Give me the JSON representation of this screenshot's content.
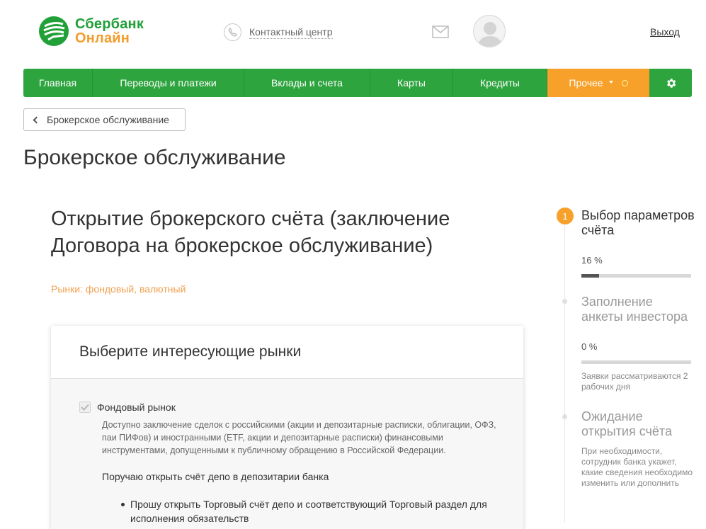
{
  "header": {
    "logo_line1": "Сбербанк",
    "logo_line2": "Онлайн",
    "contact_label": "Контактный центр",
    "logout_label": "Выход"
  },
  "nav": {
    "items": [
      "Главная",
      "Переводы и платежи",
      "Вклады и счета",
      "Карты",
      "Кредиты"
    ],
    "other_label": "Прочее"
  },
  "back_button_label": "Брокерское обслуживание",
  "page_title": "Брокерское обслуживание",
  "form": {
    "title": "Открытие брокерского счёта (заключение Договора на брокерское обслуживание)",
    "markets_note": "Рынки: фондовый, валютный",
    "card_title": "Выберите интересующие рынки",
    "checkbox_label": "Фондовый рынок",
    "checkbox_checked": true,
    "checkbox_description": "Доступно заключение сделок с российскими (акции и депозитарные расписки, облигации, ОФЗ, паи ПИФов) и иностранными (ETF, акции и депозитарные расписки) финансовыми инструментами, допущенными к публичному обращению в Российской Федерации.",
    "instruction": "Поручаю открыть счёт депо в депозитарии банка",
    "bullet": "Прошу открыть Торговый счёт депо и соответствующий Торговый раздел для исполнения обязательств"
  },
  "steps": [
    {
      "number": "1",
      "title": "Выбор параметров счёта",
      "progress_label": "16 %",
      "progress": 0.16
    },
    {
      "title": "Заполнение анкеты инвестора",
      "progress_label": "0 %",
      "progress": 0,
      "note": "Заявки рассматриваются 2 рабочих дня"
    },
    {
      "title": "Ожидание открытия счёта",
      "note": "При необходимости, сотрудник банка укажет, какие сведения необходимо изменить или дополнить"
    }
  ],
  "colors": {
    "brand_green": "#2ea43f",
    "accent_orange": "#f7a12a",
    "markets_orange": "#f0a050"
  }
}
